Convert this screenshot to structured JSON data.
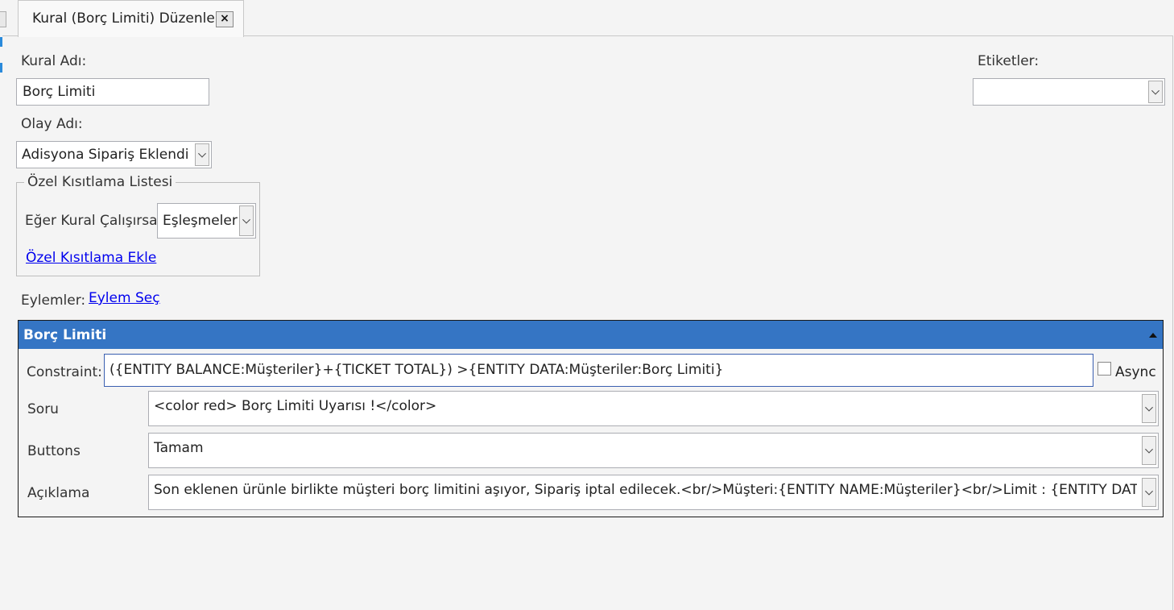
{
  "tab": {
    "title": "Kural (Borç Limiti) Düzenle",
    "close_label": "×"
  },
  "form": {
    "rule_name_label": "Kural Adı:",
    "rule_name_value": "Borç Limiti",
    "tags_label": "Etiketler:",
    "tags_value": "",
    "event_name_label": "Olay Adı:",
    "event_name_value": "Adisyona Sipariş Eklendi"
  },
  "constraints_group": {
    "legend": "Özel Kısıtlama Listesi",
    "if_rule_runs_label": "Eğer Kural Çalışırsa",
    "if_rule_runs_value": "Eşleşmeler",
    "add_constraint_link": "Özel Kısıtlama Ekle"
  },
  "actions": {
    "label": "Eylemler:",
    "select_action_link": "Eylem Seç"
  },
  "action_panel": {
    "title": "Borç Limiti",
    "constraint_label": "Constraint:",
    "constraint_value": "({ENTITY BALANCE:Müşteriler}+{TICKET TOTAL}) >{ENTITY DATA:Müşteriler:Borç Limiti}",
    "async_label": "Async",
    "async_checked": false,
    "fields": [
      {
        "label": "Soru",
        "value": "<color red> Borç Limiti Uyarısı !</color>"
      },
      {
        "label": "Buttons",
        "value": "Tamam"
      },
      {
        "label": "Açıklama",
        "value": "Son eklenen ürünle birlikte müşteri borç limitini aşıyor, Sipariş iptal edilecek.<br/>Müşteri:{ENTITY NAME:Müşteriler}<br/>Limit : {ENTITY DATA:Müşteriler:Borç Limiti}"
      }
    ]
  },
  "colors": {
    "header_blue": "#3575c4",
    "link_blue": "#0000ee",
    "accent_strip": "#2a8adb"
  }
}
